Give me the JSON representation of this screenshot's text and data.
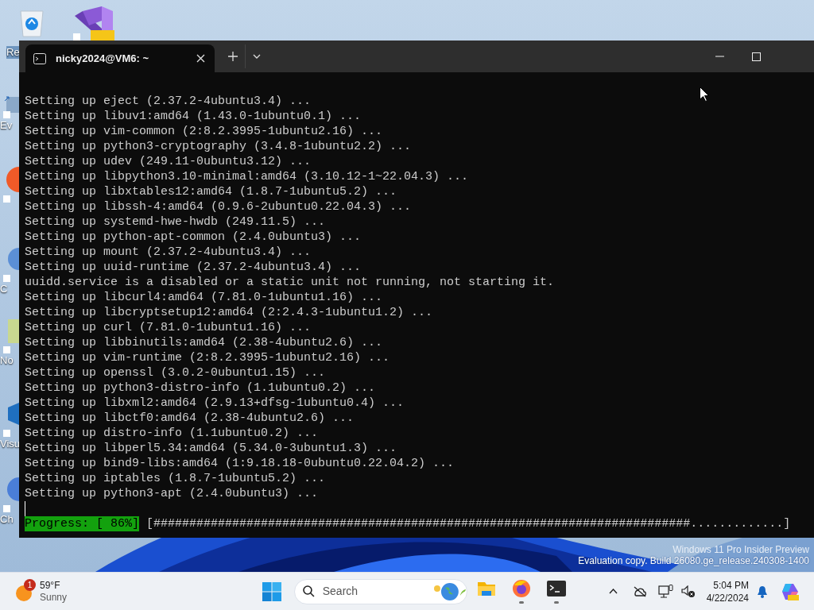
{
  "desktop": {
    "icons": [
      {
        "kind": "recycle",
        "label": "Re"
      },
      {
        "kind": "vs"
      },
      {
        "kind": "shortcut",
        "label": "Ev"
      },
      {
        "kind": "orange"
      },
      {
        "kind": "blue",
        "label": "C"
      },
      {
        "kind": "notepad",
        "label": "No"
      },
      {
        "kind": "vscode",
        "label": "Visu"
      },
      {
        "kind": "chrome",
        "label": "Ch"
      }
    ]
  },
  "window": {
    "tabs": [
      {
        "title": "nicky2024@VM6: ~",
        "selected": true
      }
    ],
    "terminal": {
      "lines": [
        "Setting up eject (2.37.2-4ubuntu3.4) ...",
        "Setting up libuv1:amd64 (1.43.0-1ubuntu0.1) ...",
        "Setting up vim-common (2:8.2.3995-1ubuntu2.16) ...",
        "Setting up python3-cryptography (3.4.8-1ubuntu2.2) ...",
        "Setting up udev (249.11-0ubuntu3.12) ...",
        "Setting up libpython3.10-minimal:amd64 (3.10.12-1~22.04.3) ...",
        "Setting up libxtables12:amd64 (1.8.7-1ubuntu5.2) ...",
        "Setting up libssh-4:amd64 (0.9.6-2ubuntu0.22.04.3) ...",
        "Setting up systemd-hwe-hwdb (249.11.5) ...",
        "Setting up python-apt-common (2.4.0ubuntu3) ...",
        "Setting up mount (2.37.2-4ubuntu3.4) ...",
        "Setting up uuid-runtime (2.37.2-4ubuntu3.4) ...",
        "uuidd.service is a disabled or a static unit not running, not starting it.",
        "Setting up libcurl4:amd64 (7.81.0-1ubuntu1.16) ...",
        "Setting up libcryptsetup12:amd64 (2:2.4.3-1ubuntu1.2) ...",
        "Setting up curl (7.81.0-1ubuntu1.16) ...",
        "Setting up libbinutils:amd64 (2.38-4ubuntu2.6) ...",
        "Setting up vim-runtime (2:8.2.3995-1ubuntu2.16) ...",
        "Setting up openssl (3.0.2-0ubuntu1.15) ...",
        "Setting up python3-distro-info (1.1ubuntu0.2) ...",
        "Setting up libxml2:amd64 (2.9.13+dfsg-1ubuntu0.4) ...",
        "Setting up libctf0:amd64 (2.38-4ubuntu2.6) ...",
        "Setting up distro-info (1.1ubuntu0.2) ...",
        "Setting up libperl5.34:amd64 (5.34.0-3ubuntu1.3) ...",
        "Setting up bind9-libs:amd64 (1:9.18.18-0ubuntu0.22.04.2) ...",
        "Setting up iptables (1.8.7-1ubuntu5.2) ...",
        "Setting up python3-apt (2.4.0ubuntu3) ..."
      ],
      "progress_label": "Progress: [ 86%]",
      "progress_bar": "[###########################################################################.............]"
    }
  },
  "watermark": [
    "Windows 11 Pro Insider Preview",
    "Evaluation copy. Build 26080.ge_release.240308-1400"
  ],
  "taskbar": {
    "weather": {
      "badge": "1",
      "temperature": "59°F",
      "condition": "Sunny"
    },
    "search": {
      "placeholder": "Search"
    },
    "apps": [
      {
        "kind": "folder",
        "running": false
      },
      {
        "kind": "firefox",
        "running": true
      },
      {
        "kind": "terminal",
        "running": true
      }
    ],
    "clock": {
      "time": "5:04 PM",
      "date": "4/22/2024"
    }
  }
}
